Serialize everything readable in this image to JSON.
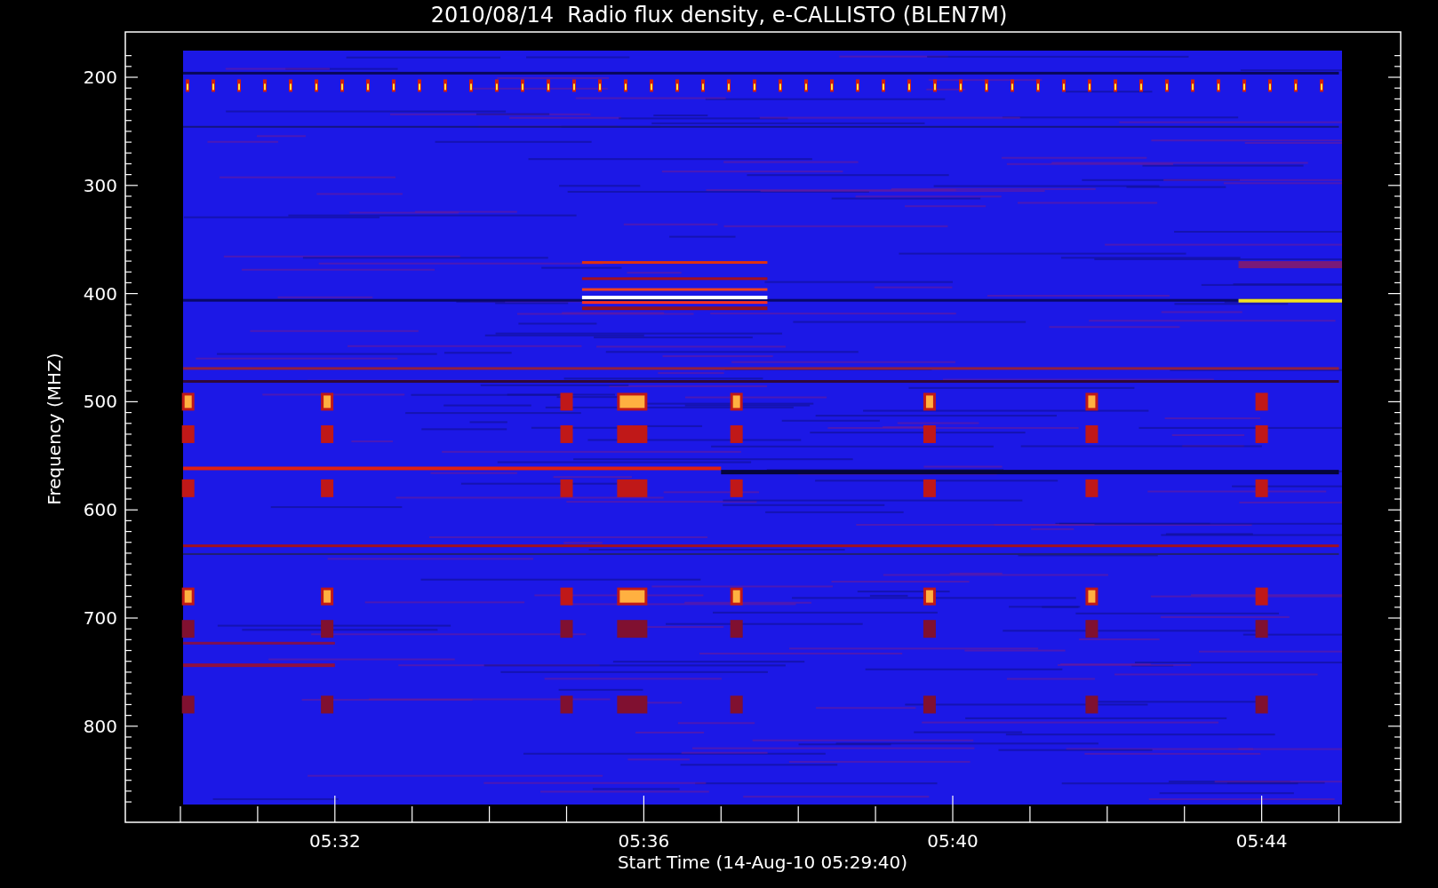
{
  "title": "2010/08/14  Radio flux density, e-CALLISTO (BLEN7M)",
  "y_axis": {
    "label": "Frequency (MHZ)",
    "tick_labels": [
      "200",
      "300",
      "400",
      "500",
      "600",
      "700",
      "800"
    ]
  },
  "x_axis": {
    "label": "Start Time (14-Aug-10 05:29:40)",
    "tick_labels": [
      "05:32",
      "05:36",
      "05:40",
      "05:44"
    ]
  }
}
